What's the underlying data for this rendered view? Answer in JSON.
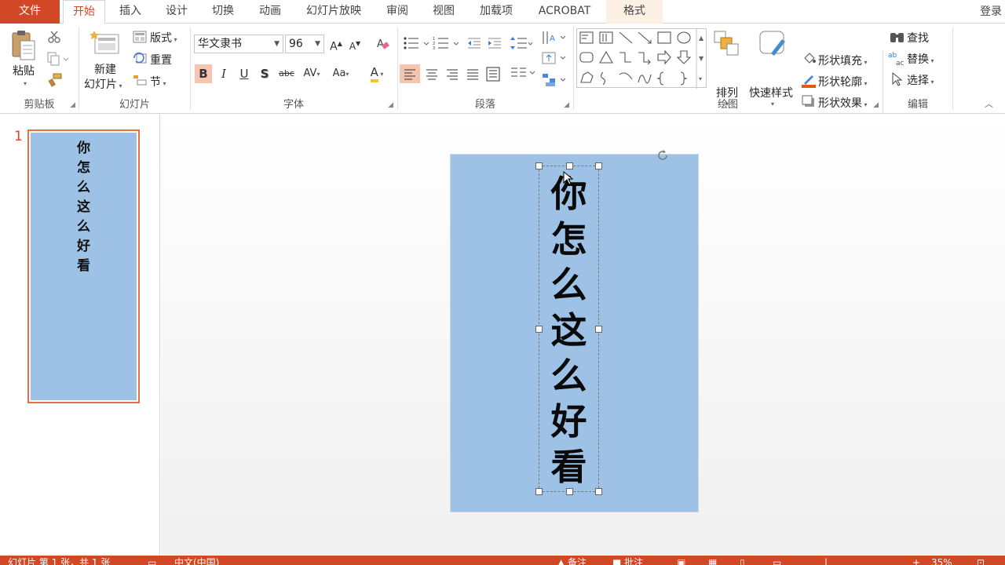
{
  "tabs": {
    "file": "文件",
    "home": "开始",
    "insert": "插入",
    "design": "设计",
    "transitions": "切换",
    "animations": "动画",
    "slideshow": "幻灯片放映",
    "review": "审阅",
    "view": "视图",
    "addins": "加载项",
    "acrobat": "ACROBAT",
    "format": "格式"
  },
  "signin": "登录",
  "ribbon": {
    "clipboard": {
      "label": "剪贴板",
      "paste": "粘贴"
    },
    "slides": {
      "label": "幻灯片",
      "new_slide_1": "新建",
      "new_slide_2": "幻灯片",
      "layout": "版式",
      "reset": "重置",
      "section": "节"
    },
    "font": {
      "label": "字体",
      "font_name": "华文隶书",
      "font_size": "96"
    },
    "paragraph": {
      "label": "段落"
    },
    "drawing": {
      "label": "绘图",
      "arrange": "排列",
      "quick_styles": "快速样式",
      "shape_fill": "形状填充",
      "shape_outline": "形状轮廓",
      "shape_effects": "形状效果"
    },
    "editing": {
      "label": "编辑",
      "find": "查找",
      "replace": "替换",
      "select": "选择"
    }
  },
  "thumbnails": [
    {
      "number": "1",
      "text": "你怎么这么好看"
    }
  ],
  "slide": {
    "text_lines": [
      "你",
      "怎",
      "么",
      "这",
      "么",
      "好",
      "看"
    ]
  },
  "statusbar": {
    "slide_info": "幻灯片 第 1 张，共 1 张",
    "language": "中文(中国)",
    "notes": "备注",
    "comments": "批注",
    "zoom": "35%"
  },
  "colors": {
    "accent": "#d24726",
    "slide_background": "#9ec2e6",
    "format_tab": "#fdf1e6"
  }
}
